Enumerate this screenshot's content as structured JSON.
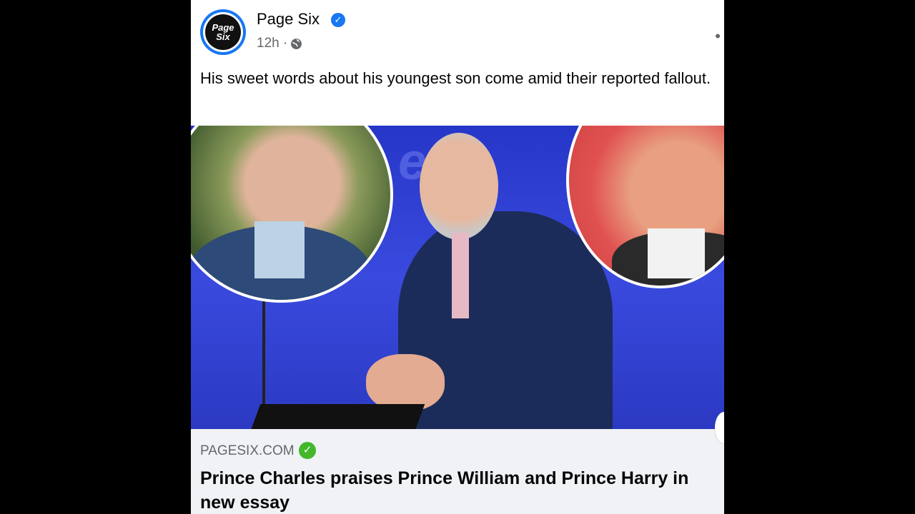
{
  "post": {
    "page_name": "Page Six",
    "avatar_text_line1": "Page",
    "avatar_text_line2": "Six",
    "timestamp": "12h ·",
    "caption": "His sweet words about his youngest son come amid their reported fallout.",
    "link": {
      "domain": "PAGESIX.COM",
      "headline": "Prince Charles praises Prince William and Prince Harry in new essay"
    }
  },
  "icons": {
    "verified": "verified-badge-icon",
    "globe": "globe-icon",
    "more": "more-options-icon",
    "domain_verified": "check-circle-icon"
  },
  "colors": {
    "brand_blue": "#1877f2",
    "check_green": "#42b72a",
    "text": "#050505",
    "muted": "#65676b"
  }
}
